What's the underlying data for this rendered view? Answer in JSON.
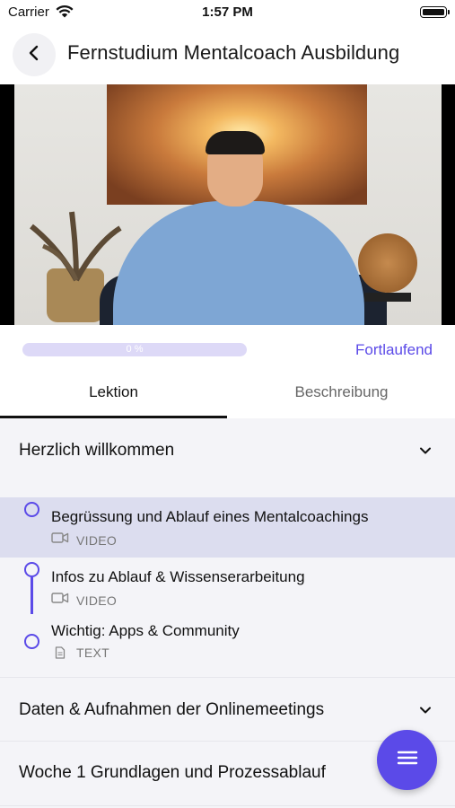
{
  "status_bar": {
    "carrier": "Carrier",
    "time": "1:57 PM"
  },
  "header": {
    "title": "Fernstudium Mentalcoach Ausbildung",
    "back_icon": "chevron-left-icon"
  },
  "video": {
    "description_icon": "video-thumbnail"
  },
  "progress": {
    "value": 0,
    "label": "0 %",
    "status": "Fortlaufend"
  },
  "tabs": [
    {
      "label": "Lektion",
      "active": true
    },
    {
      "label": "Beschreibung",
      "active": false
    }
  ],
  "sections": [
    {
      "title": "Herzlich willkommen",
      "expanded": true,
      "lessons": [
        {
          "title": "Begrüssung und Ablauf eines Mentalcoachings",
          "type": "VIDEO",
          "icon": "video-camera-icon",
          "active": true
        },
        {
          "title": "Infos zu Ablauf & Wissenserarbeitung",
          "type": "VIDEO",
          "icon": "video-camera-icon",
          "active": false
        },
        {
          "title": "Wichtig: Apps & Community",
          "type": "TEXT",
          "icon": "document-icon",
          "active": false
        }
      ]
    },
    {
      "title": "Daten & Aufnahmen der Onlinemeetings",
      "expanded": false
    },
    {
      "title": "Woche 1 Grundlagen und Prozessablauf",
      "expanded": false
    }
  ],
  "colors": {
    "accent": "#5b4ae8",
    "active_row": "#dcddef",
    "background": "#f4f4f8"
  },
  "fab": {
    "icon": "menu-icon"
  }
}
